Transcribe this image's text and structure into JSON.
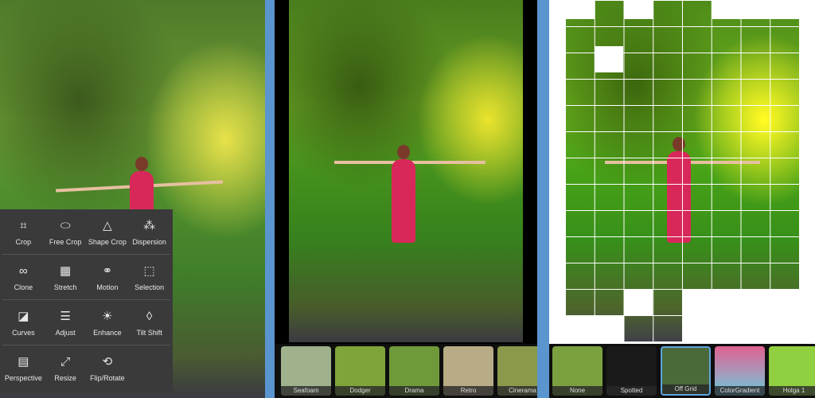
{
  "tools": [
    [
      {
        "label": "Crop",
        "icon": "crop-icon",
        "glyph": "⌗"
      },
      {
        "label": "Free Crop",
        "icon": "free-crop-icon",
        "glyph": "⬭"
      },
      {
        "label": "Shape Crop",
        "icon": "shape-crop-icon",
        "glyph": "△"
      },
      {
        "label": "Dispersion",
        "icon": "dispersion-icon",
        "glyph": "⁂"
      }
    ],
    [
      {
        "label": "Clone",
        "icon": "clone-icon",
        "glyph": "∞"
      },
      {
        "label": "Stretch",
        "icon": "stretch-icon",
        "glyph": "▦"
      },
      {
        "label": "Motion",
        "icon": "motion-icon",
        "glyph": "⚭"
      },
      {
        "label": "Selection",
        "icon": "selection-icon",
        "glyph": "⬚"
      }
    ],
    [
      {
        "label": "Curves",
        "icon": "curves-icon",
        "glyph": "◪"
      },
      {
        "label": "Adjust",
        "icon": "adjust-icon",
        "glyph": "☰"
      },
      {
        "label": "Enhance",
        "icon": "enhance-icon",
        "glyph": "☀"
      },
      {
        "label": "Tilt Shift",
        "icon": "tilt-shift-icon",
        "glyph": "◊"
      }
    ],
    [
      {
        "label": "Perspective",
        "icon": "perspective-icon",
        "glyph": "▤"
      },
      {
        "label": "Resize",
        "icon": "resize-icon",
        "glyph": "⤢"
      },
      {
        "label": "Flip/Rotate",
        "icon": "flip-rotate-icon",
        "glyph": "⟲"
      }
    ]
  ],
  "filters_middle": [
    "Seafoam",
    "Dodger",
    "Drama",
    "Retro",
    "Cinerama"
  ],
  "filters_right": [
    "None",
    "Spotted",
    "Off Grid",
    "ColorGradient",
    "Holga 1"
  ],
  "selected_filter": "Off Grid",
  "colors": {
    "separator": "#5b95cf",
    "selection": "#5fa4e0",
    "tool_panel": "#3a3a3a"
  }
}
